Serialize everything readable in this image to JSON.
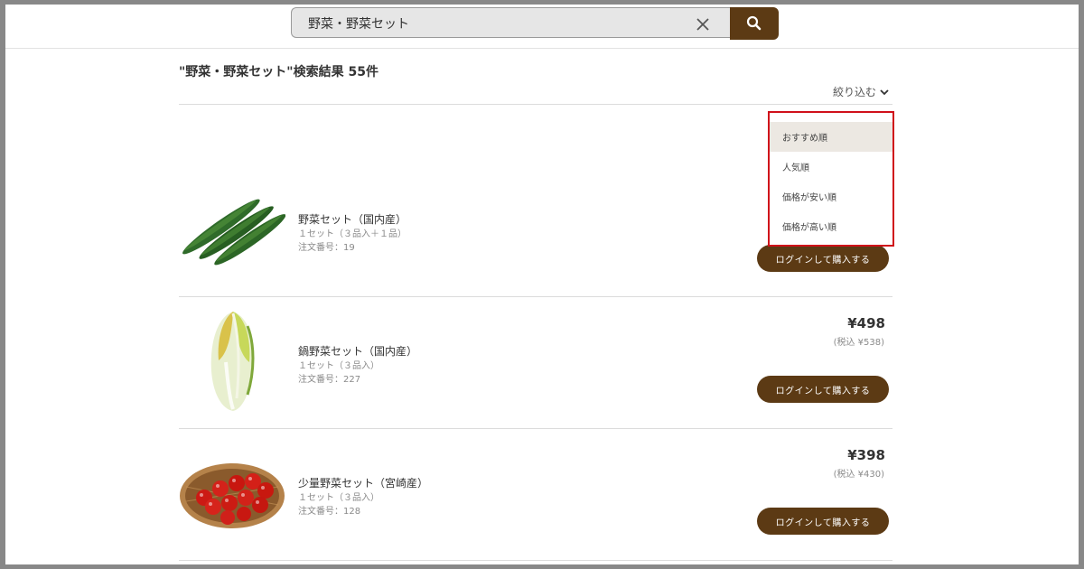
{
  "search": {
    "query": "野菜・野菜セット"
  },
  "results": {
    "title": "\"野菜・野菜セット\"検索結果 55件",
    "filter_label": "絞り込む"
  },
  "sort_options": [
    {
      "label": "おすすめ順",
      "selected": true
    },
    {
      "label": "人気順",
      "selected": false
    },
    {
      "label": "価格が安い順",
      "selected": false
    },
    {
      "label": "価格が高い順",
      "selected": false
    }
  ],
  "products": [
    {
      "name": "野菜セット（国内産）",
      "quantity": "１セット（３品入＋１品）",
      "order_no": "注文番号：19",
      "price": "",
      "tax_price": "",
      "button": "ログインして購入する",
      "image": "cucumber"
    },
    {
      "name": "鍋野菜セット（国内産）",
      "quantity": "１セット（３品入）",
      "order_no": "注文番号：227",
      "price": "¥498",
      "tax_price": "(税込 ¥538)",
      "button": "ログインして購入する",
      "image": "napa-cabbage"
    },
    {
      "name": "少量野菜セット（宮崎産）",
      "quantity": "１セット（３品入）",
      "order_no": "注文番号：128",
      "price": "¥398",
      "tax_price": "(税込 ¥430)",
      "button": "ログインして購入する",
      "image": "cherry-tomatoes"
    }
  ],
  "colors": {
    "brand": "#5c3a14",
    "highlight_border": "#d0101a",
    "selected_option_bg": "#ece8e2"
  }
}
